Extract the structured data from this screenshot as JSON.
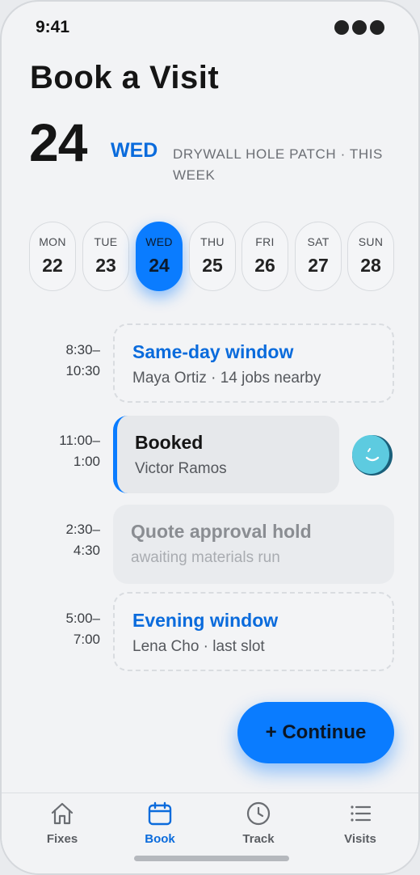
{
  "status": {
    "time": "9:41"
  },
  "header": {
    "title": "Book a Visit",
    "date_number": "24",
    "day_of_week": "WED",
    "subtitle": "DRYWALL HOLE PATCH · THIS WEEK"
  },
  "days": [
    {
      "dow": "MON",
      "num": "22"
    },
    {
      "dow": "TUE",
      "num": "23"
    },
    {
      "dow": "WED",
      "num": "24",
      "selected": true
    },
    {
      "dow": "THU",
      "num": "25"
    },
    {
      "dow": "FRI",
      "num": "26"
    },
    {
      "dow": "SAT",
      "num": "27"
    },
    {
      "dow": "SUN",
      "num": "28"
    }
  ],
  "slots": [
    {
      "time_start": "8:30–",
      "time_end": "10:30",
      "title": "Same-day window",
      "subtitle": "Maya Ortiz · 14 jobs nearby",
      "state": "open"
    },
    {
      "time_start": "11:00–",
      "time_end": "1:00",
      "title": "Booked",
      "subtitle": "Victor Ramos",
      "state": "booked"
    },
    {
      "time_start": "2:30–",
      "time_end": "4:30",
      "title": "Quote approval hold",
      "subtitle": "awaiting materials run",
      "state": "hold"
    },
    {
      "time_start": "5:00–",
      "time_end": "7:00",
      "title": "Evening window",
      "subtitle": "Lena Cho · last slot",
      "state": "open"
    }
  ],
  "continue_label": "+ Continue",
  "tabs": [
    {
      "label": "Fixes",
      "icon": "home-icon"
    },
    {
      "label": "Book",
      "icon": "calendar-icon",
      "active": true
    },
    {
      "label": "Track",
      "icon": "clock-icon"
    },
    {
      "label": "Visits",
      "icon": "list-icon"
    }
  ],
  "colors": {
    "accent": "#0a7cff",
    "background": "#f2f3f5"
  }
}
